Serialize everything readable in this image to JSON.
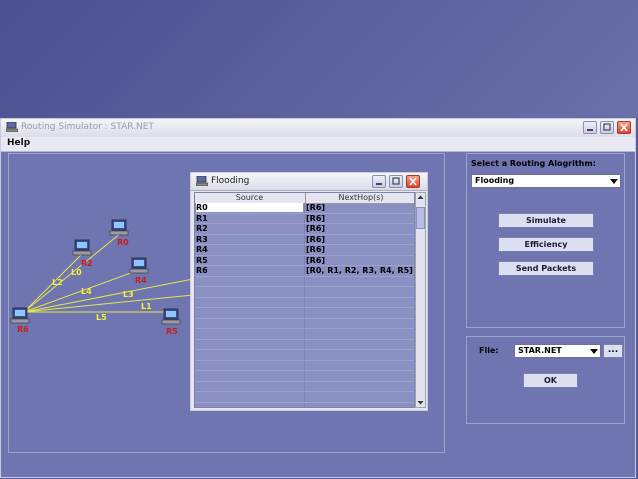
{
  "window": {
    "title": "Routing Simulator  : STAR.NET",
    "menu": {
      "help": "Help"
    }
  },
  "topology": {
    "nodes": [
      "R0",
      "R2",
      "R4",
      "R5",
      "R6"
    ],
    "links": [
      "L0",
      "L2",
      "L4",
      "L3",
      "L1",
      "L5"
    ],
    "link_color": "#f2f230",
    "node_label_color": "#c81e1e"
  },
  "flooding": {
    "title": "Flooding",
    "columns": [
      "Source",
      "NextHop(s)"
    ],
    "rows": [
      {
        "source": "R0",
        "nexthop": "[R6]"
      },
      {
        "source": "R1",
        "nexthop": "[R6]"
      },
      {
        "source": "R2",
        "nexthop": "[R6]"
      },
      {
        "source": "R3",
        "nexthop": "[R6]"
      },
      {
        "source": "R4",
        "nexthop": "[R6]"
      },
      {
        "source": "R5",
        "nexthop": "[R6]"
      },
      {
        "source": "R6",
        "nexthop": "[R0, R1, R2, R3, R4, R5]"
      }
    ]
  },
  "controls": {
    "select_label": "Select a Routing Alogrithm:",
    "algorithm": "Flooding",
    "simulate": "Simulate",
    "efficiency": "Efficiency",
    "send_packets": "Send Packets",
    "file_label": "File:",
    "file": "STAR.NET",
    "browse": "...",
    "ok": "OK"
  }
}
